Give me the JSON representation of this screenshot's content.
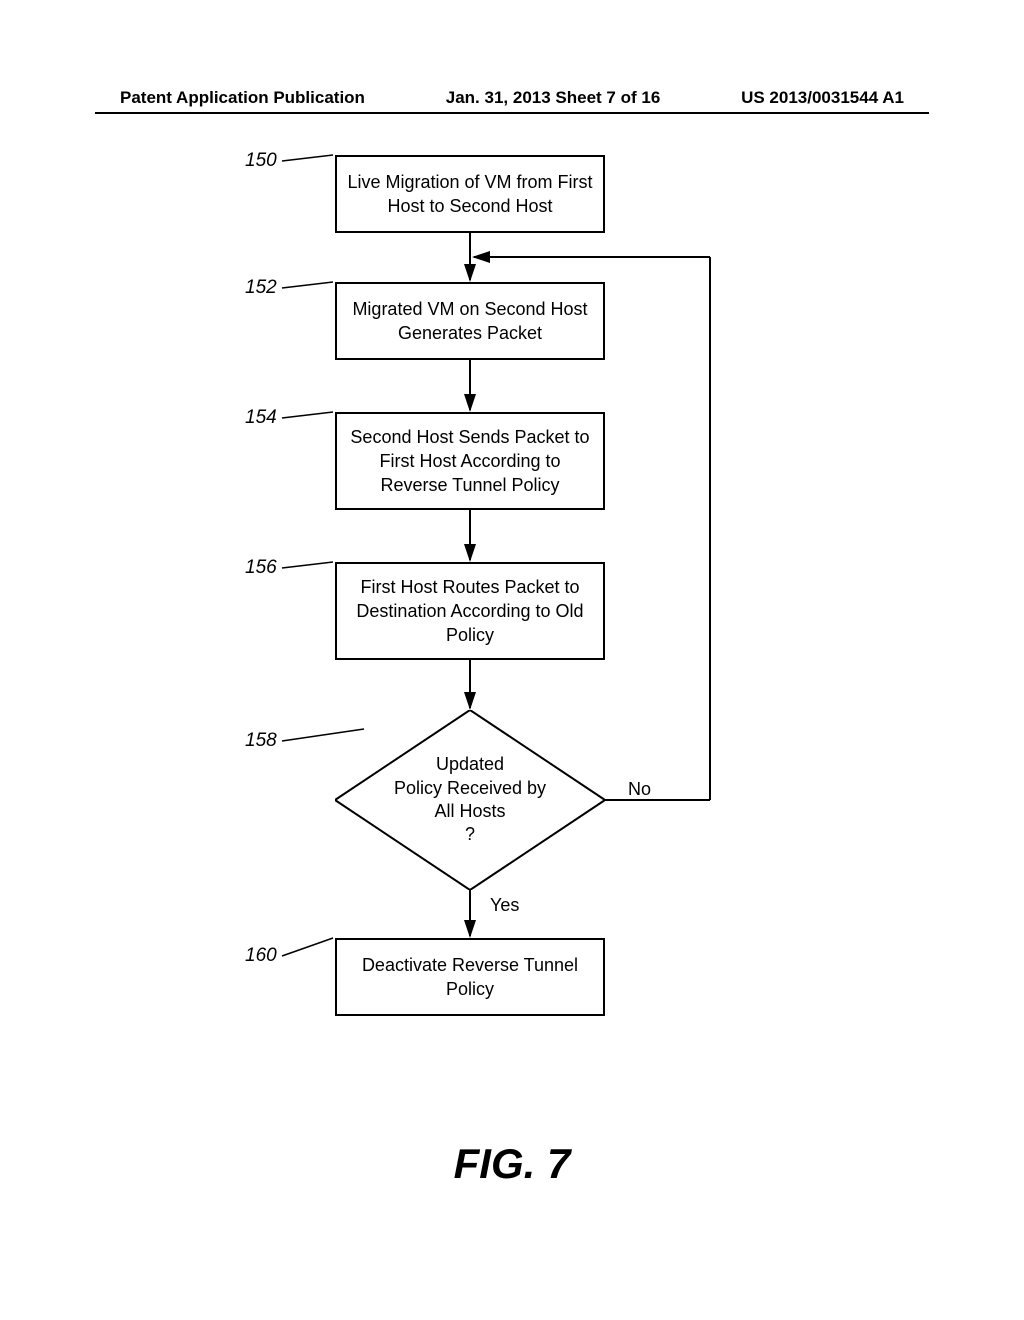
{
  "header": {
    "left": "Patent Application Publication",
    "center": "Jan. 31, 2013  Sheet 7 of 16",
    "right": "US 2013/0031544 A1"
  },
  "boxes": {
    "b150_ref": "150",
    "b150_text": "Live Migration of VM from First Host to Second Host",
    "b152_ref": "152",
    "b152_text": "Migrated VM on Second Host Generates Packet",
    "b154_ref": "154",
    "b154_text": "Second Host Sends Packet to First Host According to Reverse Tunnel Policy",
    "b156_ref": "156",
    "b156_text": "First Host Routes Packet to Destination According to Old Policy",
    "b158_ref": "158",
    "b160_ref": "160",
    "b160_text": "Deactivate Reverse Tunnel Policy"
  },
  "diamond": {
    "line1": "Updated",
    "line2": "Policy Received by",
    "line3": "All Hosts",
    "line4": "?"
  },
  "labels": {
    "no": "No",
    "yes": "Yes"
  },
  "figure": "FIG. 7"
}
